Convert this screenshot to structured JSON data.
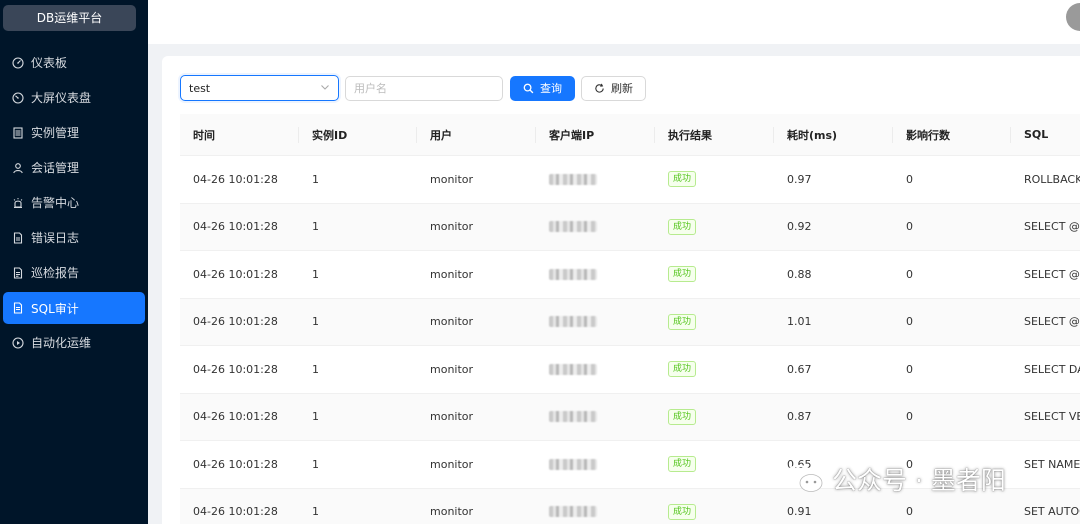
{
  "sidebar": {
    "logo": "DB运维平台",
    "items": [
      {
        "label": "仪表板",
        "icon": "dashboard-icon"
      },
      {
        "label": "大屏仪表盘",
        "icon": "gauge-icon"
      },
      {
        "label": "实例管理",
        "icon": "database-icon"
      },
      {
        "label": "会话管理",
        "icon": "user-icon"
      },
      {
        "label": "告警中心",
        "icon": "alarm-icon"
      },
      {
        "label": "错误日志",
        "icon": "file-icon"
      },
      {
        "label": "巡检报告",
        "icon": "report-icon"
      },
      {
        "label": "SQL审计",
        "icon": "audit-icon",
        "active": true
      },
      {
        "label": "自动化运维",
        "icon": "play-circle-icon"
      }
    ]
  },
  "toolbar": {
    "instance_value": "test",
    "username_placeholder": "用户名",
    "query_label": "查询",
    "refresh_label": "刷新"
  },
  "table": {
    "columns": [
      "时间",
      "实例ID",
      "用户",
      "客户端IP",
      "执行结果",
      "耗时(ms)",
      "影响行数",
      "SQL"
    ],
    "rows": [
      {
        "time": "04-26 10:01:28",
        "instance": "1",
        "user": "monitor",
        "result": "成功",
        "cost": "0.97",
        "affected": "0",
        "sql": "ROLLBACK"
      },
      {
        "time": "04-26 10:01:28",
        "instance": "1",
        "user": "monitor",
        "result": "成功",
        "cost": "0.92",
        "affected": "0",
        "sql": "SELECT @@"
      },
      {
        "time": "04-26 10:01:28",
        "instance": "1",
        "user": "monitor",
        "result": "成功",
        "cost": "0.88",
        "affected": "0",
        "sql": "SELECT @@"
      },
      {
        "time": "04-26 10:01:28",
        "instance": "1",
        "user": "monitor",
        "result": "成功",
        "cost": "1.01",
        "affected": "0",
        "sql": "SELECT @@"
      },
      {
        "time": "04-26 10:01:28",
        "instance": "1",
        "user": "monitor",
        "result": "成功",
        "cost": "0.67",
        "affected": "0",
        "sql": "SELECT DAT"
      },
      {
        "time": "04-26 10:01:28",
        "instance": "1",
        "user": "monitor",
        "result": "成功",
        "cost": "0.87",
        "affected": "0",
        "sql": "SELECT VER"
      },
      {
        "time": "04-26 10:01:28",
        "instance": "1",
        "user": "monitor",
        "result": "成功",
        "cost": "0.65",
        "affected": "0",
        "sql": "SET NAMES"
      },
      {
        "time": "04-26 10:01:28",
        "instance": "1",
        "user": "monitor",
        "result": "成功",
        "cost": "0.91",
        "affected": "0",
        "sql": "SET AUTOC"
      }
    ]
  },
  "watermark": "公众号 · 墨者阳",
  "colors": {
    "sidebar_bg": "#001529",
    "accent": "#1677ff",
    "success": "#52c41a"
  }
}
